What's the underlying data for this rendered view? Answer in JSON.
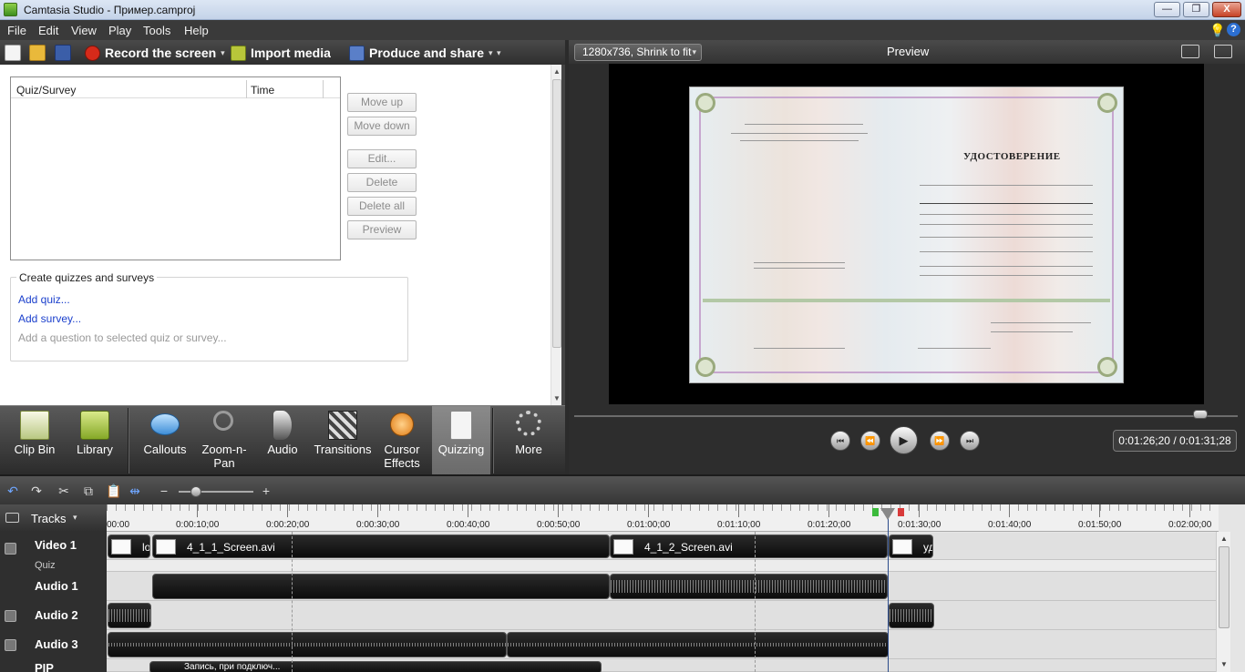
{
  "window": {
    "title": "Camtasia Studio - Пример.camproj",
    "minimize": "—",
    "maximize": "❐",
    "close": "X"
  },
  "menu": [
    "File",
    "Edit",
    "View",
    "Play",
    "Tools",
    "Help"
  ],
  "toolbar": {
    "record": "Record the screen",
    "import": "Import media",
    "produce": "Produce and share",
    "caret": "▾"
  },
  "quiz_panel": {
    "col_quiz": "Quiz/Survey",
    "col_time": "Time",
    "buttons": [
      "Move up",
      "Move down",
      "Edit...",
      "Delete",
      "Delete all",
      "Preview"
    ],
    "create_title": "Create quizzes and surveys",
    "add_quiz": "Add quiz...",
    "add_survey": "Add survey...",
    "add_question": "Add a question to selected quiz or survey..."
  },
  "tabs": [
    {
      "label": "Clip Bin",
      "icon": "clip-bin-icon"
    },
    {
      "label": "Library",
      "icon": "library-icon"
    },
    {
      "label": "Callouts",
      "icon": "callouts-icon"
    },
    {
      "label": "Zoom-n-Pan",
      "icon": "zoom-icon"
    },
    {
      "label": "Audio",
      "icon": "audio-icon"
    },
    {
      "label": "Transitions",
      "icon": "transitions-icon"
    },
    {
      "label": "Cursor Effects",
      "icon": "cursor-effects-icon"
    },
    {
      "label": "Quizzing",
      "icon": "quizzing-icon",
      "active": true
    },
    {
      "label": "More",
      "icon": "more-icon"
    }
  ],
  "preview": {
    "size_combo": "1280x736, Shrink to fit",
    "title": "Preview",
    "cert_heading": "УДОСТОВЕРЕНИЕ",
    "time": "0:01:26;20 / 0:01:31;28",
    "playback_position": 0.944
  },
  "timeline": {
    "tracks_label": "Tracks",
    "ruler": [
      "00:00",
      "0:00:10;00",
      "0:00:20;00",
      "0:00:30;00",
      "0:00:40;00",
      "0:00:50;00",
      "0:01:00;00",
      "0:01:10;00",
      "0:01:20;00",
      "0:01:30;00",
      "0:01:40;00",
      "0:01:50;00",
      "0:02:00;00"
    ],
    "tracks": [
      "Video 1",
      "Quiz",
      "Audio 1",
      "Audio 2",
      "Audio 3",
      "PIP"
    ],
    "clips": {
      "v1_a": "lo",
      "v1_b": "4_1_1_Screen.avi",
      "v1_c": "4_1_2_Screen.avi",
      "v1_d": "уд",
      "pip": "Запись, при подключ..."
    }
  },
  "colors": {
    "accent_record": "#d62a1a",
    "panel_dark": "#2f2f2f",
    "link": "#1a3fcc"
  }
}
